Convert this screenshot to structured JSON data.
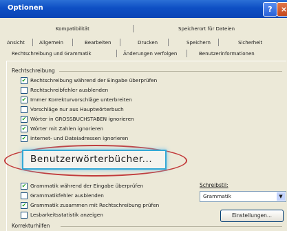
{
  "window": {
    "title": "Optionen"
  },
  "tabs": {
    "row1": [
      "Kompatibilität",
      "Speicherort für Dateien"
    ],
    "row2": [
      "Ansicht",
      "Allgemein",
      "Bearbeiten",
      "Drucken",
      "Speichern",
      "Sicherheit"
    ],
    "row3": [
      "Rechtschreibung und Grammatik",
      "Änderungen verfolgen",
      "Benutzerinformationen"
    ]
  },
  "spelling": {
    "label": "Rechtschreibung",
    "options": [
      {
        "label": "Rechtschreibung während der Eingabe überprüfen",
        "checked": true
      },
      {
        "label": "Rechtschreibfehler ausblenden",
        "checked": false
      },
      {
        "label": "Immer Korrekturvorschläge unterbreiten",
        "checked": true
      },
      {
        "label": "Vorschläge nur aus Hauptwörterbuch",
        "checked": false
      },
      {
        "label": "Wörter in GROSSBUCHSTABEN ignorieren",
        "checked": true
      },
      {
        "label": "Wörter mit Zahlen ignorieren",
        "checked": true
      },
      {
        "label": "Internet- und Dateiadressen ignorieren",
        "checked": true
      }
    ],
    "dictionaries_button": "Benutzerwörterbücher..."
  },
  "grammar": {
    "options": [
      {
        "label": "Grammatik während der Eingabe überprüfen",
        "checked": true
      },
      {
        "label": "Grammatikfehler ausblenden",
        "checked": false
      },
      {
        "label": "Grammatik zusammen mit Rechtschreibung prüfen",
        "checked": true
      },
      {
        "label": "Lesbarkeitsstatistik anzeigen",
        "checked": false
      }
    ],
    "style_label": "Schreibstil:",
    "style_value": "Grammatik",
    "settings_button": "Einstellungen..."
  },
  "tools": {
    "label": "Korrekturhilfen"
  },
  "colors": {
    "titlebar": "#0e4fc4",
    "highlight": "#c23a3a",
    "check": "#21a121"
  }
}
